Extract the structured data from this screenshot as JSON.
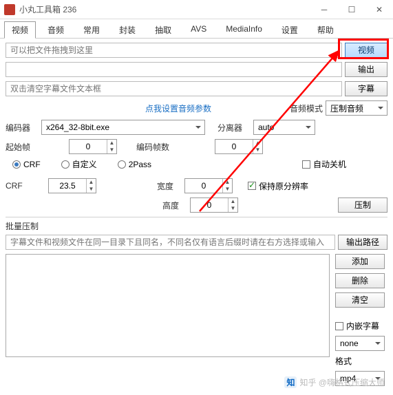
{
  "title": "小丸工具箱 236",
  "tabs": [
    "视频",
    "音频",
    "常用",
    "封装",
    "抽取",
    "AVS",
    "MediaInfo",
    "设置",
    "帮助"
  ],
  "active_tab": 0,
  "drop_hint_1": "可以把文件拖拽到这里",
  "drop_hint_2": "双击清空字幕文件文本框",
  "btns": {
    "video": "视频",
    "output": "输出",
    "subtitle": "字幕",
    "compress": "压制",
    "out_path": "输出路径",
    "add": "添加",
    "delete": "删除",
    "clear": "清空"
  },
  "link_audio": "点我设置音频参数",
  "labels": {
    "encoder": "编码器",
    "start_frame": "起始帧",
    "enc_frames": "编码帧数",
    "audio_mode": "音频模式",
    "separator": "分离器",
    "auto_off": "自动关机",
    "width": "宽度",
    "height": "高度",
    "keep_res": "保持原分辨率",
    "batch": "批量压制",
    "embed_sub": "内嵌字幕",
    "format": "格式"
  },
  "radios": {
    "crf": "CRF",
    "custom": "自定义",
    "twopass": "2Pass"
  },
  "values": {
    "encoder": "x264_32-8bit.exe",
    "start_frame": "0",
    "enc_frames": "0",
    "audio_mode": "压制音频",
    "separator": "auto",
    "crf": "23.5",
    "width": "0",
    "height": "0",
    "format_sel": "none",
    "format_ext": "mp4"
  },
  "batch_hint": "字幕文件和视频文件在同一目录下且同名，不同名仅有语言后缀时请在右方选择或输入",
  "watermark": "知乎 @嗨格式压缩大师"
}
